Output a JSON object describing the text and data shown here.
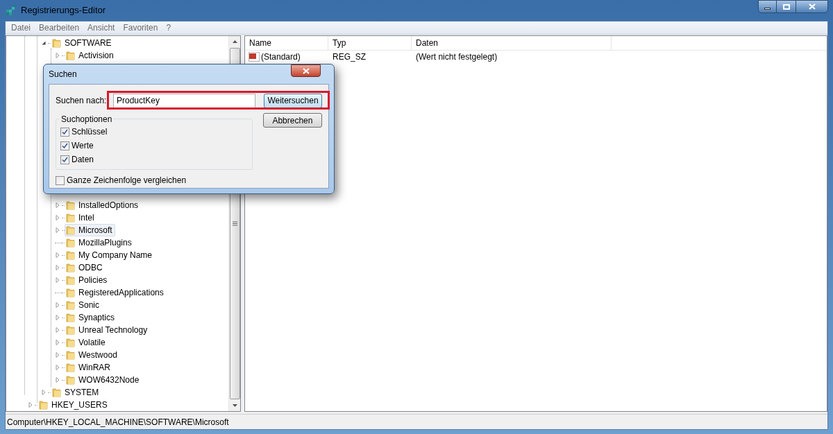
{
  "window": {
    "title": "Registrierungs-Editor"
  },
  "menu": [
    "Datei",
    "Bearbeiten",
    "Ansicht",
    "Favoriten",
    "?"
  ],
  "tree": {
    "items": [
      {
        "label": "SOFTWARE",
        "expanded": true,
        "has_children": true,
        "selected": false,
        "children": [
          {
            "label": "Activision",
            "has_children": true,
            "selected": false
          },
          {
            "label": "InstalledOptions",
            "has_children": true,
            "selected": false
          },
          {
            "label": "Intel",
            "has_children": true,
            "selected": false
          },
          {
            "label": "Microsoft",
            "has_children": true,
            "selected": true
          },
          {
            "label": "MozillaPlugins",
            "has_children": false,
            "selected": false
          },
          {
            "label": "My Company Name",
            "has_children": true,
            "selected": false
          },
          {
            "label": "ODBC",
            "has_children": true,
            "selected": false
          },
          {
            "label": "Policies",
            "has_children": true,
            "selected": false
          },
          {
            "label": "RegisteredApplications",
            "has_children": false,
            "selected": false
          },
          {
            "label": "Sonic",
            "has_children": true,
            "selected": false
          },
          {
            "label": "Synaptics",
            "has_children": true,
            "selected": false
          },
          {
            "label": "Unreal Technology",
            "has_children": true,
            "selected": false
          },
          {
            "label": "Volatile",
            "has_children": true,
            "selected": false
          },
          {
            "label": "Westwood",
            "has_children": true,
            "selected": false
          },
          {
            "label": "WinRAR",
            "has_children": true,
            "selected": false
          },
          {
            "label": "WOW6432Node",
            "has_children": true,
            "selected": false
          }
        ]
      },
      {
        "label": "SYSTEM",
        "expanded": false,
        "has_children": true,
        "selected": false
      }
    ],
    "root_items": [
      {
        "label": "HKEY_USERS",
        "expanded": false,
        "has_children": true,
        "selected": false
      }
    ]
  },
  "table": {
    "columns": [
      "Name",
      "Typ",
      "Daten"
    ],
    "rows": [
      [
        "(Standard)",
        "REG_SZ",
        "(Wert nicht festgelegt)"
      ]
    ]
  },
  "status_bar": "Computer\\HKEY_LOCAL_MACHINE\\SOFTWARE\\Microsoft",
  "dialog": {
    "title": "Suchen",
    "search_label": "Suchen nach:",
    "search_value": "ProductKey",
    "find_button": "Weitersuchen",
    "cancel_button": "Abbrechen",
    "options_title": "Suchoptionen",
    "options": [
      {
        "label": "Schlüssel",
        "checked": true
      },
      {
        "label": "Werte",
        "checked": true
      },
      {
        "label": "Daten",
        "checked": true
      }
    ],
    "whole_string": {
      "label": "Ganze Zeichenfolge vergleichen",
      "checked": false
    }
  }
}
